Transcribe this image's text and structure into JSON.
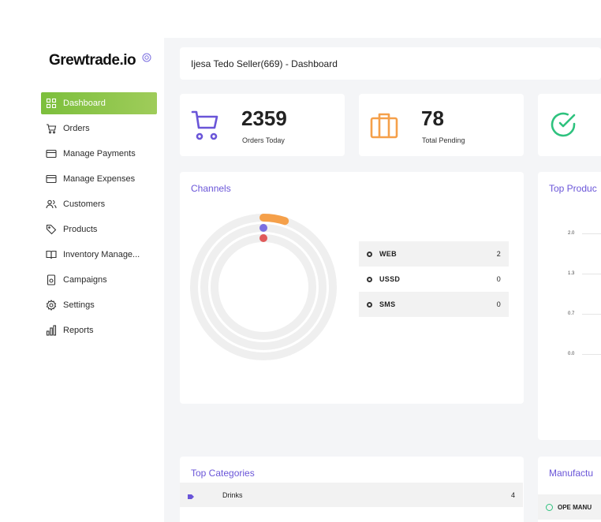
{
  "app": {
    "logo_text": "Grewtrade.io"
  },
  "sidebar": {
    "items": [
      {
        "label": "Dashboard",
        "icon": "grid-icon",
        "active": true
      },
      {
        "label": "Orders",
        "icon": "cart-icon"
      },
      {
        "label": "Manage Payments",
        "icon": "card-icon"
      },
      {
        "label": "Manage Expenses",
        "icon": "card-icon"
      },
      {
        "label": "Customers",
        "icon": "users-icon"
      },
      {
        "label": "Products",
        "icon": "tag-icon"
      },
      {
        "label": "Inventory Manage...",
        "icon": "book-icon"
      },
      {
        "label": "Campaigns",
        "icon": "campaign-icon"
      },
      {
        "label": "Settings",
        "icon": "gear-icon"
      },
      {
        "label": "Reports",
        "icon": "bar-chart-icon"
      }
    ]
  },
  "header": {
    "title": "Ijesa Tedo Seller(669) - Dashboard"
  },
  "stats": [
    {
      "value": "2359",
      "label": "Orders Today",
      "icon": "cart-icon",
      "color": "#6a55d8"
    },
    {
      "value": "78",
      "label": "Total Pending",
      "icon": "briefcase-icon",
      "color": "#f5a04a"
    },
    {
      "value": "",
      "label": "",
      "icon": "check-circle-icon",
      "color": "#2ec27e"
    }
  ],
  "channels": {
    "title": "Channels",
    "colors": {
      "web": "#f5a04a",
      "ussd": "#7a6ee0",
      "sms": "#e05a5a",
      "track": "#efefef"
    },
    "chart_data": {
      "type": "pie",
      "categories": [
        "WEB",
        "USSD",
        "SMS"
      ],
      "values": [
        2,
        0,
        0
      ]
    }
  },
  "top_products": {
    "title": "Top Produc",
    "ticks": [
      "2.0",
      "1.3",
      "0.7",
      "0.0"
    ]
  },
  "top_categories": {
    "title": "Top Categories",
    "rows": [
      {
        "name": "Drinks",
        "count": "4"
      }
    ]
  },
  "manufacturers": {
    "title": "Manufactu",
    "rows": [
      {
        "name": "OPE MANU"
      }
    ]
  }
}
